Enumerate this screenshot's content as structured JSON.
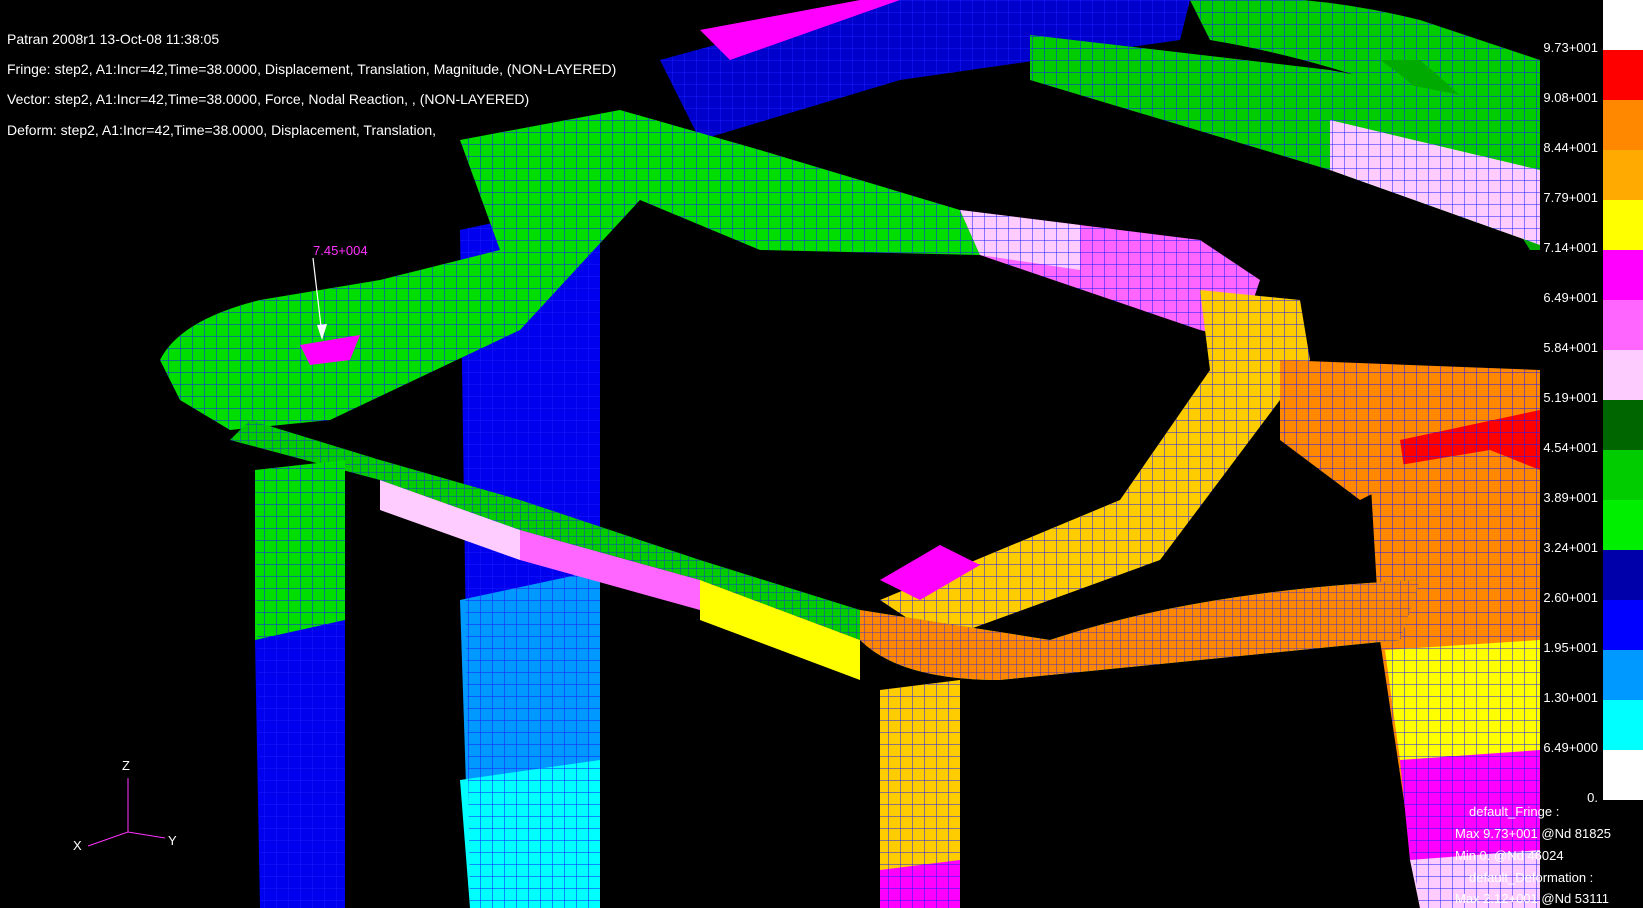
{
  "header": {
    "line1": "Patran 2008r1 13-Oct-08 11:38:05",
    "line2": "Fringe: step2, A1:Incr=42,Time=38.0000, Displacement, Translation, Magnitude, (NON-LAYERED)",
    "line3": "Vector: step2, A1:Incr=42,Time=38.0000, Force, Nodal Reaction, , (NON-LAYERED)",
    "line4": "Deform: step2, A1:Incr=42,Time=38.0000, Displacement, Translation,"
  },
  "annotation": {
    "vector_value": "7.45+004"
  },
  "axes": {
    "z": "Z",
    "x": "X",
    "y": "Y"
  },
  "legend": {
    "labels": [
      "9.73+001",
      "9.08+001",
      "8.44+001",
      "7.79+001",
      "7.14+001",
      "6.49+001",
      "5.84+001",
      "5.19+001",
      "4.54+001",
      "3.89+001",
      "3.24+001",
      "2.60+001",
      "1.95+001",
      "1.30+001",
      "6.49+000",
      "0."
    ],
    "colors": [
      "#ffffff",
      "#ff0000",
      "#ff8800",
      "#ffaa00",
      "#ffff00",
      "#ff00ff",
      "#ff66ff",
      "#ffccff",
      "#006600",
      "#00cc00",
      "#00ee00",
      "#0000aa",
      "#0000ff",
      "#0099ff",
      "#00ffff",
      "#ffffff"
    ]
  },
  "summary": {
    "line1": "default_Fringe :",
    "line2": "Max 9.73+001 @Nd 81825",
    "line3": "Min 0. @Nd 46024",
    "line4": "default_Deformation :",
    "line5": "Max 2.12+001 @Nd 53111"
  },
  "colors": {
    "background": "#000000",
    "mesh": "#1a1aff",
    "text": "#ffffff",
    "annotation": "#ff33ff"
  }
}
